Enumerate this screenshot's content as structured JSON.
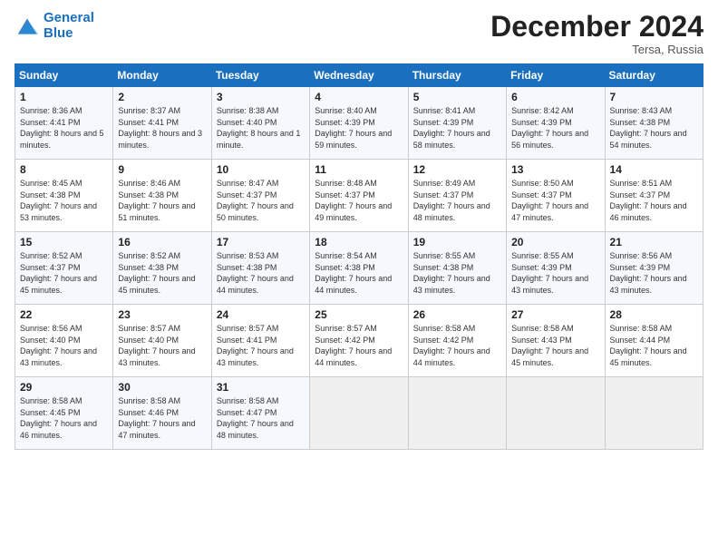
{
  "header": {
    "logo_line1": "General",
    "logo_line2": "Blue",
    "month": "December 2024",
    "location": "Tersa, Russia"
  },
  "weekdays": [
    "Sunday",
    "Monday",
    "Tuesday",
    "Wednesday",
    "Thursday",
    "Friday",
    "Saturday"
  ],
  "weeks": [
    [
      {
        "day": "1",
        "sunrise": "8:36 AM",
        "sunset": "4:41 PM",
        "daylight": "8 hours and 5 minutes."
      },
      {
        "day": "2",
        "sunrise": "8:37 AM",
        "sunset": "4:41 PM",
        "daylight": "8 hours and 3 minutes."
      },
      {
        "day": "3",
        "sunrise": "8:38 AM",
        "sunset": "4:40 PM",
        "daylight": "8 hours and 1 minute."
      },
      {
        "day": "4",
        "sunrise": "8:40 AM",
        "sunset": "4:39 PM",
        "daylight": "7 hours and 59 minutes."
      },
      {
        "day": "5",
        "sunrise": "8:41 AM",
        "sunset": "4:39 PM",
        "daylight": "7 hours and 58 minutes."
      },
      {
        "day": "6",
        "sunrise": "8:42 AM",
        "sunset": "4:39 PM",
        "daylight": "7 hours and 56 minutes."
      },
      {
        "day": "7",
        "sunrise": "8:43 AM",
        "sunset": "4:38 PM",
        "daylight": "7 hours and 54 minutes."
      }
    ],
    [
      {
        "day": "8",
        "sunrise": "8:45 AM",
        "sunset": "4:38 PM",
        "daylight": "7 hours and 53 minutes."
      },
      {
        "day": "9",
        "sunrise": "8:46 AM",
        "sunset": "4:38 PM",
        "daylight": "7 hours and 51 minutes."
      },
      {
        "day": "10",
        "sunrise": "8:47 AM",
        "sunset": "4:37 PM",
        "daylight": "7 hours and 50 minutes."
      },
      {
        "day": "11",
        "sunrise": "8:48 AM",
        "sunset": "4:37 PM",
        "daylight": "7 hours and 49 minutes."
      },
      {
        "day": "12",
        "sunrise": "8:49 AM",
        "sunset": "4:37 PM",
        "daylight": "7 hours and 48 minutes."
      },
      {
        "day": "13",
        "sunrise": "8:50 AM",
        "sunset": "4:37 PM",
        "daylight": "7 hours and 47 minutes."
      },
      {
        "day": "14",
        "sunrise": "8:51 AM",
        "sunset": "4:37 PM",
        "daylight": "7 hours and 46 minutes."
      }
    ],
    [
      {
        "day": "15",
        "sunrise": "8:52 AM",
        "sunset": "4:37 PM",
        "daylight": "7 hours and 45 minutes."
      },
      {
        "day": "16",
        "sunrise": "8:52 AM",
        "sunset": "4:38 PM",
        "daylight": "7 hours and 45 minutes."
      },
      {
        "day": "17",
        "sunrise": "8:53 AM",
        "sunset": "4:38 PM",
        "daylight": "7 hours and 44 minutes."
      },
      {
        "day": "18",
        "sunrise": "8:54 AM",
        "sunset": "4:38 PM",
        "daylight": "7 hours and 44 minutes."
      },
      {
        "day": "19",
        "sunrise": "8:55 AM",
        "sunset": "4:38 PM",
        "daylight": "7 hours and 43 minutes."
      },
      {
        "day": "20",
        "sunrise": "8:55 AM",
        "sunset": "4:39 PM",
        "daylight": "7 hours and 43 minutes."
      },
      {
        "day": "21",
        "sunrise": "8:56 AM",
        "sunset": "4:39 PM",
        "daylight": "7 hours and 43 minutes."
      }
    ],
    [
      {
        "day": "22",
        "sunrise": "8:56 AM",
        "sunset": "4:40 PM",
        "daylight": "7 hours and 43 minutes."
      },
      {
        "day": "23",
        "sunrise": "8:57 AM",
        "sunset": "4:40 PM",
        "daylight": "7 hours and 43 minutes."
      },
      {
        "day": "24",
        "sunrise": "8:57 AM",
        "sunset": "4:41 PM",
        "daylight": "7 hours and 43 minutes."
      },
      {
        "day": "25",
        "sunrise": "8:57 AM",
        "sunset": "4:42 PM",
        "daylight": "7 hours and 44 minutes."
      },
      {
        "day": "26",
        "sunrise": "8:58 AM",
        "sunset": "4:42 PM",
        "daylight": "7 hours and 44 minutes."
      },
      {
        "day": "27",
        "sunrise": "8:58 AM",
        "sunset": "4:43 PM",
        "daylight": "7 hours and 45 minutes."
      },
      {
        "day": "28",
        "sunrise": "8:58 AM",
        "sunset": "4:44 PM",
        "daylight": "7 hours and 45 minutes."
      }
    ],
    [
      {
        "day": "29",
        "sunrise": "8:58 AM",
        "sunset": "4:45 PM",
        "daylight": "7 hours and 46 minutes."
      },
      {
        "day": "30",
        "sunrise": "8:58 AM",
        "sunset": "4:46 PM",
        "daylight": "7 hours and 47 minutes."
      },
      {
        "day": "31",
        "sunrise": "8:58 AM",
        "sunset": "4:47 PM",
        "daylight": "7 hours and 48 minutes."
      },
      null,
      null,
      null,
      null
    ]
  ],
  "labels": {
    "sunrise": "Sunrise:",
    "sunset": "Sunset:",
    "daylight": "Daylight:"
  }
}
